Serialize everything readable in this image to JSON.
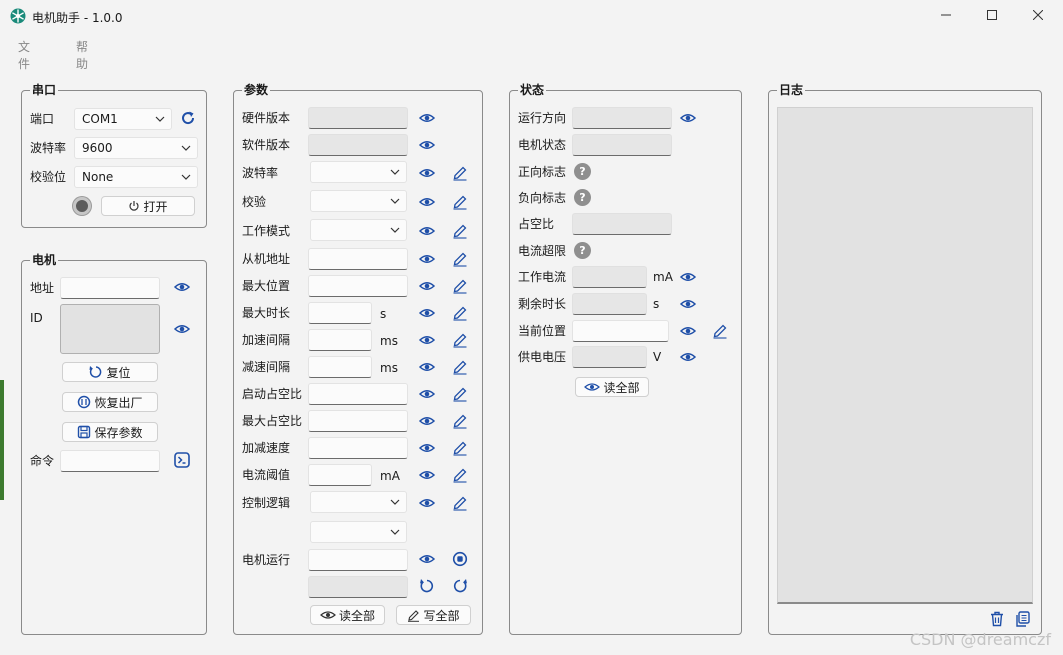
{
  "window": {
    "title": "电机助手 - 1.0.0"
  },
  "menu": [
    "文件",
    "帮助"
  ],
  "serial": {
    "title": "串口",
    "port_label": "端口",
    "port_value": "COM1",
    "baud_label": "波特率",
    "baud_value": "9600",
    "parity_label": "校验位",
    "parity_value": "None",
    "open_label": "打开"
  },
  "motor": {
    "title": "电机",
    "address_label": "地址",
    "id_label": "ID",
    "reset_label": "复位",
    "factory_label": "恢复出厂",
    "save_label": "保存参数",
    "command_label": "命令"
  },
  "params": {
    "title": "参数",
    "rows": [
      "硬件版本",
      "软件版本",
      "波特率",
      "校验",
      "工作模式",
      "从机地址",
      "最大位置",
      "最大时长",
      "加速间隔",
      "减速间隔",
      "启动占空比",
      "最大占空比",
      "加减速度",
      "电流阈值",
      "控制逻辑"
    ],
    "units": {
      "max_time": "s",
      "accel": "ms",
      "decel": "ms",
      "current": "mA"
    },
    "run_label": "电机运行",
    "read_all": "读全部",
    "write_all": "写全部"
  },
  "status": {
    "title": "状态",
    "rows": [
      "运行方向",
      "电机状态",
      "正向标志",
      "负向标志",
      "占空比",
      "电流超限",
      "工作电流",
      "剩余时长",
      "当前位置",
      "供电电压"
    ],
    "units": {
      "current": "mA",
      "remaining": "s",
      "voltage": "V"
    },
    "help_glyph": "?",
    "read_all": "读全部"
  },
  "log": {
    "title": "日志"
  },
  "watermark": "CSDN @dreamczf",
  "colors": {
    "accent": "#1f4fa8",
    "window_bg": "#f3f3f3",
    "readonly": "#e6e6e6"
  }
}
